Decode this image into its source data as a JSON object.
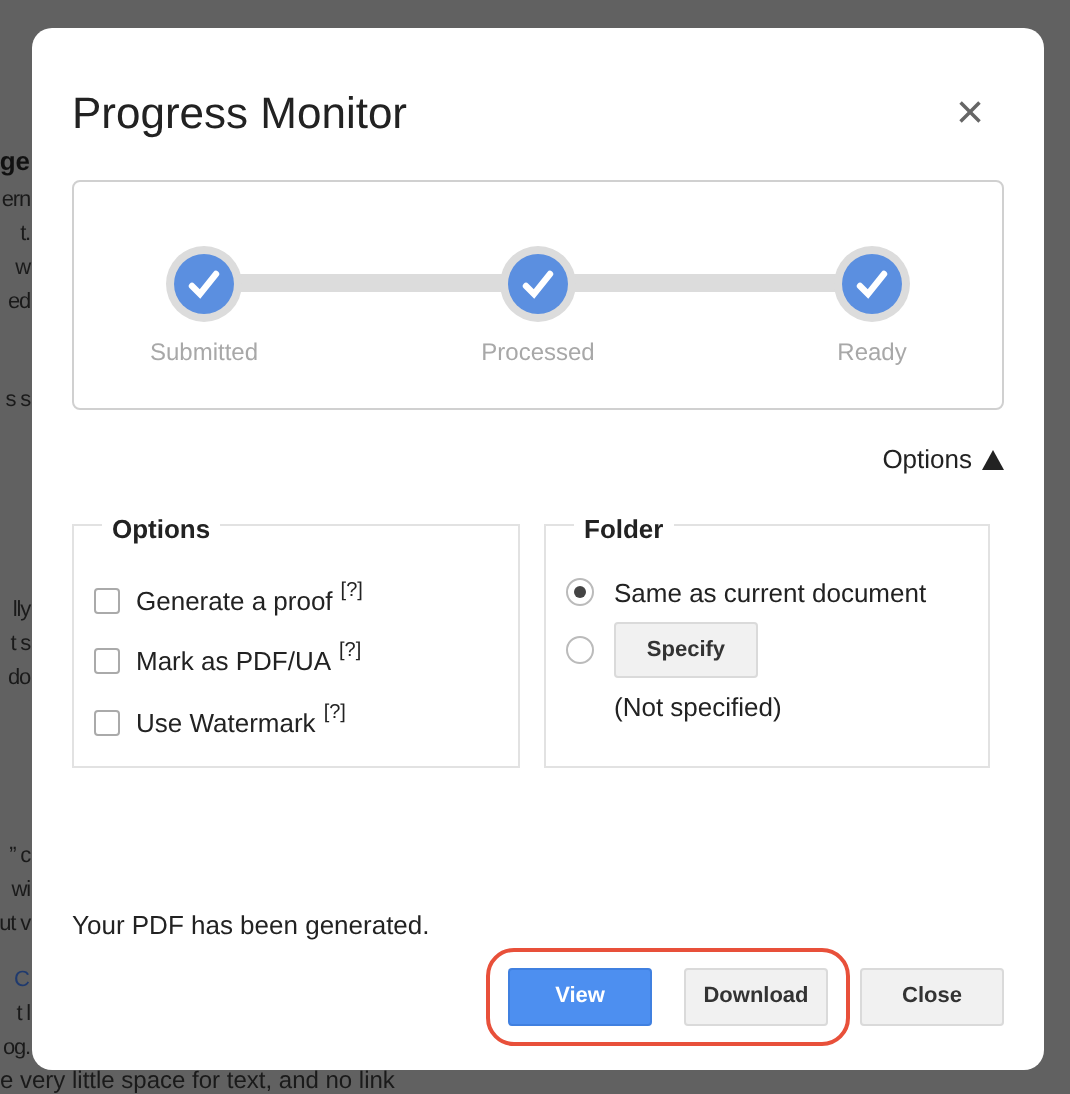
{
  "background_document": {
    "paragraphs": [
      {
        "kind": "heading",
        "lines": [
          "ge"
        ]
      },
      {
        "kind": "text",
        "lines": [
          "ern",
          "t.",
          "w",
          "ed"
        ]
      },
      {
        "kind": "text",
        "lines": [
          "s s"
        ]
      },
      {
        "kind": "text",
        "lines": [
          "lly",
          "t s",
          "do"
        ]
      },
      {
        "kind": "text",
        "lines": [
          "” c",
          "wi",
          "ut v"
        ]
      },
      {
        "kind": "link",
        "lines": [
          "C"
        ]
      },
      {
        "kind": "text",
        "lines": [
          "t l",
          "og."
        ]
      }
    ],
    "bottom_line": "e very little space for text, and no link"
  },
  "dialog": {
    "title": "Progress Monitor",
    "close_label": "×",
    "steps": [
      {
        "label": "Submitted",
        "done": true
      },
      {
        "label": "Processed",
        "done": true
      },
      {
        "label": "Ready",
        "done": true
      }
    ],
    "options_toggle": {
      "label": "Options",
      "expanded": true
    },
    "options": {
      "legend": "Options",
      "items": [
        {
          "label": "Generate a proof",
          "help": "[?]",
          "checked": false
        },
        {
          "label": "Mark as PDF/UA",
          "help": "[?]",
          "checked": false
        },
        {
          "label": "Use Watermark",
          "help": "[?]",
          "checked": false
        }
      ]
    },
    "folder": {
      "legend": "Folder",
      "choices": [
        {
          "kind": "text",
          "label": "Same as current document",
          "selected": true
        },
        {
          "kind": "button",
          "label": "Specify",
          "note": "(Not specified)",
          "selected": false
        }
      ]
    },
    "message": "Your PDF has been generated.",
    "buttons": [
      {
        "label": "View",
        "kind": "primary",
        "highlighted": true
      },
      {
        "label": "Download",
        "kind": "secondary",
        "highlighted": true
      },
      {
        "label": "Close",
        "kind": "secondary",
        "highlighted": false
      }
    ]
  }
}
